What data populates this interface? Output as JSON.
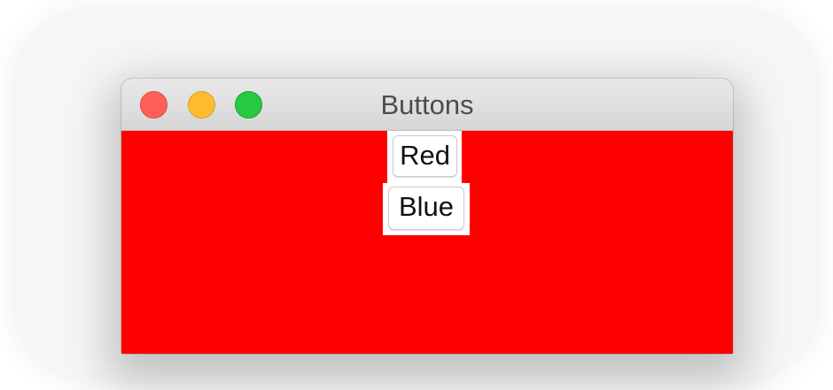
{
  "window": {
    "title": "Buttons",
    "content_background": "#ff0000"
  },
  "traffic_lights": [
    {
      "name": "close",
      "color": "#ff5f57"
    },
    {
      "name": "minimize",
      "color": "#febc2e"
    },
    {
      "name": "zoom",
      "color": "#28c840"
    }
  ],
  "buttons": [
    {
      "label": "Red"
    },
    {
      "label": "Blue"
    }
  ]
}
